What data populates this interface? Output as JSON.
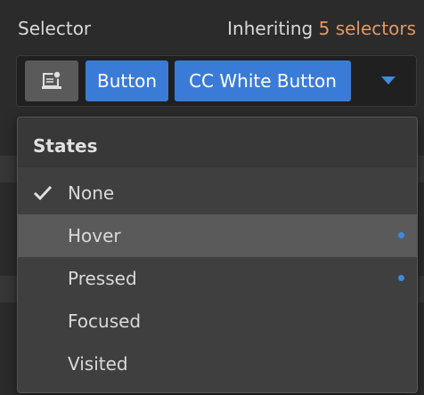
{
  "header": {
    "title": "Selector",
    "inherit_prefix": "Inheriting ",
    "inherit_count_text": "5 selectors"
  },
  "selector_bar": {
    "icon": "component-icon",
    "chips": [
      {
        "label": "Button"
      },
      {
        "label": "CC White Button"
      }
    ],
    "dropdown_icon": "caret-down-icon"
  },
  "states_menu": {
    "title": "States",
    "items": [
      {
        "label": "None",
        "checked": true,
        "has_styles": false
      },
      {
        "label": "Hover",
        "checked": false,
        "has_styles": true,
        "hovered": true
      },
      {
        "label": "Pressed",
        "checked": false,
        "has_styles": true
      },
      {
        "label": "Focused",
        "checked": false,
        "has_styles": false
      },
      {
        "label": "Visited",
        "checked": false,
        "has_styles": false
      }
    ]
  },
  "colors": {
    "accent_orange": "#e8965a",
    "chip_blue": "#3b7bd8",
    "dot_blue": "#3d8ae0",
    "background": "#2b2b2b"
  }
}
